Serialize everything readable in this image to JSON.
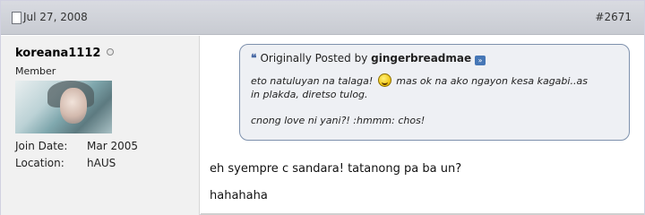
{
  "post": {
    "date": "Jul 27, 2008",
    "number": "#2671"
  },
  "user": {
    "name": "koreana1112",
    "title": "Member",
    "join_label": "Join Date:",
    "join_value": "Mar 2005",
    "location_label": "Location:",
    "location_value": "hAUS"
  },
  "quote": {
    "prefix": "Originally Posted by",
    "author": "gingerbreadmae",
    "line1_part1": "eto natuluyan na talaga!",
    "line1_part2": "mas ok na ako ngayon kesa kagabi..as",
    "line2": "in plakda, diretso tulog.",
    "line3": "cnong love ni yani?! :hmmm: chos!"
  },
  "message": {
    "line1": "eh syempre c sandara! tatanong pa ba un?",
    "line2": "hahahaha"
  },
  "icons": {
    "post_icon": "document-icon",
    "status": "offline-status-icon",
    "quote_marks": "quote-icon",
    "view_post": "view-post-icon",
    "smiley": "grin-smiley-icon"
  }
}
